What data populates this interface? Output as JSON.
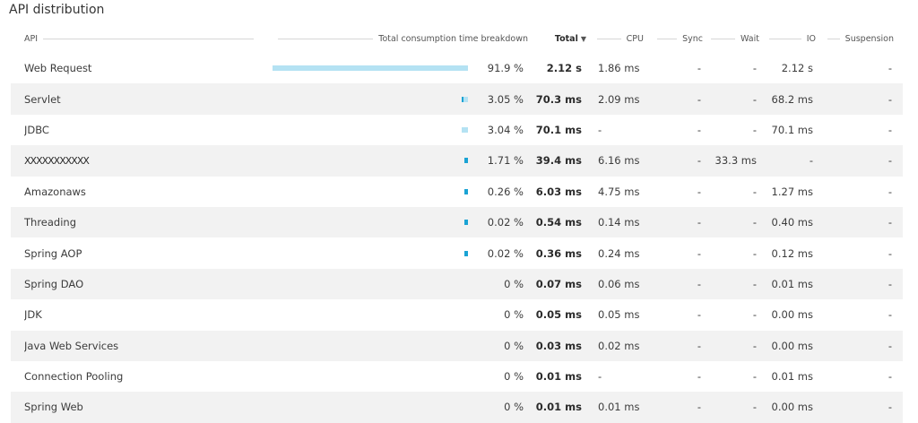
{
  "page": {
    "title": "API distribution"
  },
  "columns": {
    "api": "API",
    "breakdown": "Total consumption time breakdown",
    "total": "Total",
    "total_sort": "▼",
    "cpu": "CPU",
    "sync": "Sync",
    "wait": "Wait",
    "io": "IO",
    "suspension": "Suspension"
  },
  "colors": {
    "bar_light": "#b4e2f3",
    "bar_dark": "#1aa3d4",
    "row_alt": "#f2f2f2"
  },
  "rows": [
    {
      "api": "Web Request",
      "share": 0.919,
      "pct": "91.9 %",
      "total": "2.12 s",
      "cpu": "1.86 ms",
      "sync": "-",
      "wait": "-",
      "io": "2.12 s",
      "suspension": "-"
    },
    {
      "api": "Servlet",
      "share": 0.0305,
      "pct": "3.05 %",
      "total": "70.3 ms",
      "cpu": "2.09 ms",
      "sync": "-",
      "wait": "-",
      "io": "68.2 ms",
      "suspension": "-"
    },
    {
      "api": "JDBC",
      "share": 0.0304,
      "pct": "3.04 %",
      "total": "70.1 ms",
      "cpu": "-",
      "sync": "-",
      "wait": "-",
      "io": "70.1 ms",
      "suspension": "-"
    },
    {
      "api": "XXXXXXXXXXX",
      "share": 0.0171,
      "pct": "1.71 %",
      "total": "39.4 ms",
      "cpu": "6.16 ms",
      "sync": "-",
      "wait": "33.3 ms",
      "io": "-",
      "suspension": "-"
    },
    {
      "api": "Amazonaws",
      "share": 0.0026,
      "pct": "0.26 %",
      "total": "6.03 ms",
      "cpu": "4.75 ms",
      "sync": "-",
      "wait": "-",
      "io": "1.27 ms",
      "suspension": "-"
    },
    {
      "api": "Threading",
      "share": 0.0002,
      "pct": "0.02 %",
      "total": "0.54 ms",
      "cpu": "0.14 ms",
      "sync": "-",
      "wait": "-",
      "io": "0.40 ms",
      "suspension": "-"
    },
    {
      "api": "Spring AOP",
      "share": 0.0002,
      "pct": "0.02 %",
      "total": "0.36 ms",
      "cpu": "0.24 ms",
      "sync": "-",
      "wait": "-",
      "io": "0.12 ms",
      "suspension": "-"
    },
    {
      "api": "Spring DAO",
      "share": 0,
      "pct": "0 %",
      "total": "0.07 ms",
      "cpu": "0.06 ms",
      "sync": "-",
      "wait": "-",
      "io": "0.01 ms",
      "suspension": "-"
    },
    {
      "api": "JDK",
      "share": 0,
      "pct": "0 %",
      "total": "0.05 ms",
      "cpu": "0.05 ms",
      "sync": "-",
      "wait": "-",
      "io": "0.00 ms",
      "suspension": "-"
    },
    {
      "api": "Java Web Services",
      "share": 0,
      "pct": "0 %",
      "total": "0.03 ms",
      "cpu": "0.02 ms",
      "sync": "-",
      "wait": "-",
      "io": "0.00 ms",
      "suspension": "-"
    },
    {
      "api": "Connection Pooling",
      "share": 0,
      "pct": "0 %",
      "total": "0.01 ms",
      "cpu": "-",
      "sync": "-",
      "wait": "-",
      "io": "0.01 ms",
      "suspension": "-"
    },
    {
      "api": "Spring Web",
      "share": 0,
      "pct": "0 %",
      "total": "0.01 ms",
      "cpu": "0.01 ms",
      "sync": "-",
      "wait": "-",
      "io": "0.00 ms",
      "suspension": "-"
    }
  ]
}
